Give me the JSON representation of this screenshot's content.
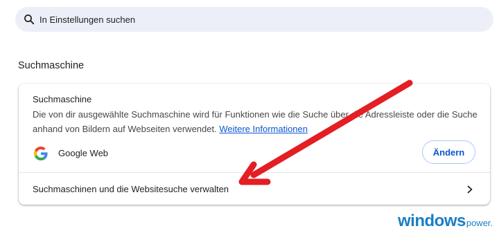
{
  "search": {
    "placeholder": "In Einstellungen suchen",
    "icon": "search-icon"
  },
  "section": {
    "title": "Suchmaschine"
  },
  "card": {
    "title": "Suchmaschine",
    "description": "Die von dir ausgewählte Suchmaschine wird für Funktionen wie die Suche über die Adressleiste oder die Suche anhand von Bildern auf Webseiten verwendet.",
    "more_info_link": "Weitere Informationen",
    "engine": {
      "icon": "google-g-icon",
      "name": "Google Web"
    },
    "change_button": "Ändern",
    "manage_row": {
      "label": "Suchmaschinen und die Websitesuche verwalten",
      "icon": "chevron-right-icon"
    }
  },
  "annotation": {
    "arrow_color": "#e31e24"
  },
  "watermark": {
    "main": "windows",
    "sub": "power."
  },
  "colors": {
    "accent": "#0b57d0",
    "search_bg": "#eceff7",
    "watermark": "#1a7ec4"
  }
}
